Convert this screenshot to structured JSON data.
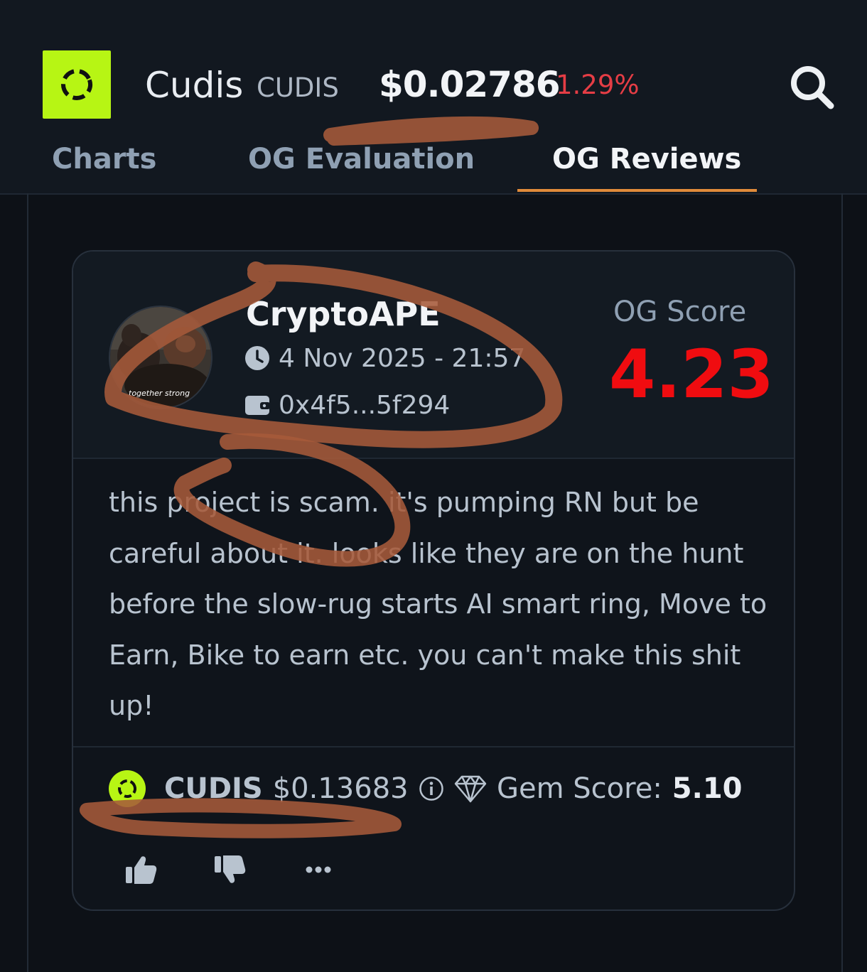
{
  "header": {
    "token_name": "Cudis",
    "token_symbol": "CUDIS",
    "price": "$0.02786",
    "change": "1.29%"
  },
  "tabs": [
    {
      "label": "Charts",
      "active": false
    },
    {
      "label": "OG Evaluation",
      "active": false
    },
    {
      "label": "OG Reviews",
      "active": true
    }
  ],
  "review": {
    "reviewer": "CryptoAPE",
    "avatar_caption": "together strong",
    "timestamp": "4 Nov 2025 - 21:57",
    "wallet": "0x4f5...5f294",
    "og_score_label": "OG Score",
    "og_score": "4.23",
    "text": "this project is scam. it's pumping RN but be careful about it. looks like they are on the hunt before the slow-rug starts AI smart ring, Move to Earn, Bike to earn etc. you can't make this shit up!",
    "token_symbol": "CUDIS",
    "token_price": "$0.13683",
    "gem_label": "Gem Score:",
    "gem_score": "5.10"
  },
  "icons": {
    "search": "search-icon",
    "clock": "clock-icon",
    "wallet": "wallet-icon",
    "info": "info-icon",
    "gem": "diamond-icon",
    "like": "thumbs-up-icon",
    "dislike": "thumbs-down-icon",
    "more": "more-icon"
  },
  "colors": {
    "brand": "#b7f514",
    "accent_tab": "#e08b3a",
    "negative": "#e53d45",
    "score": "#f00c10",
    "annotation": "#a65a3a"
  }
}
